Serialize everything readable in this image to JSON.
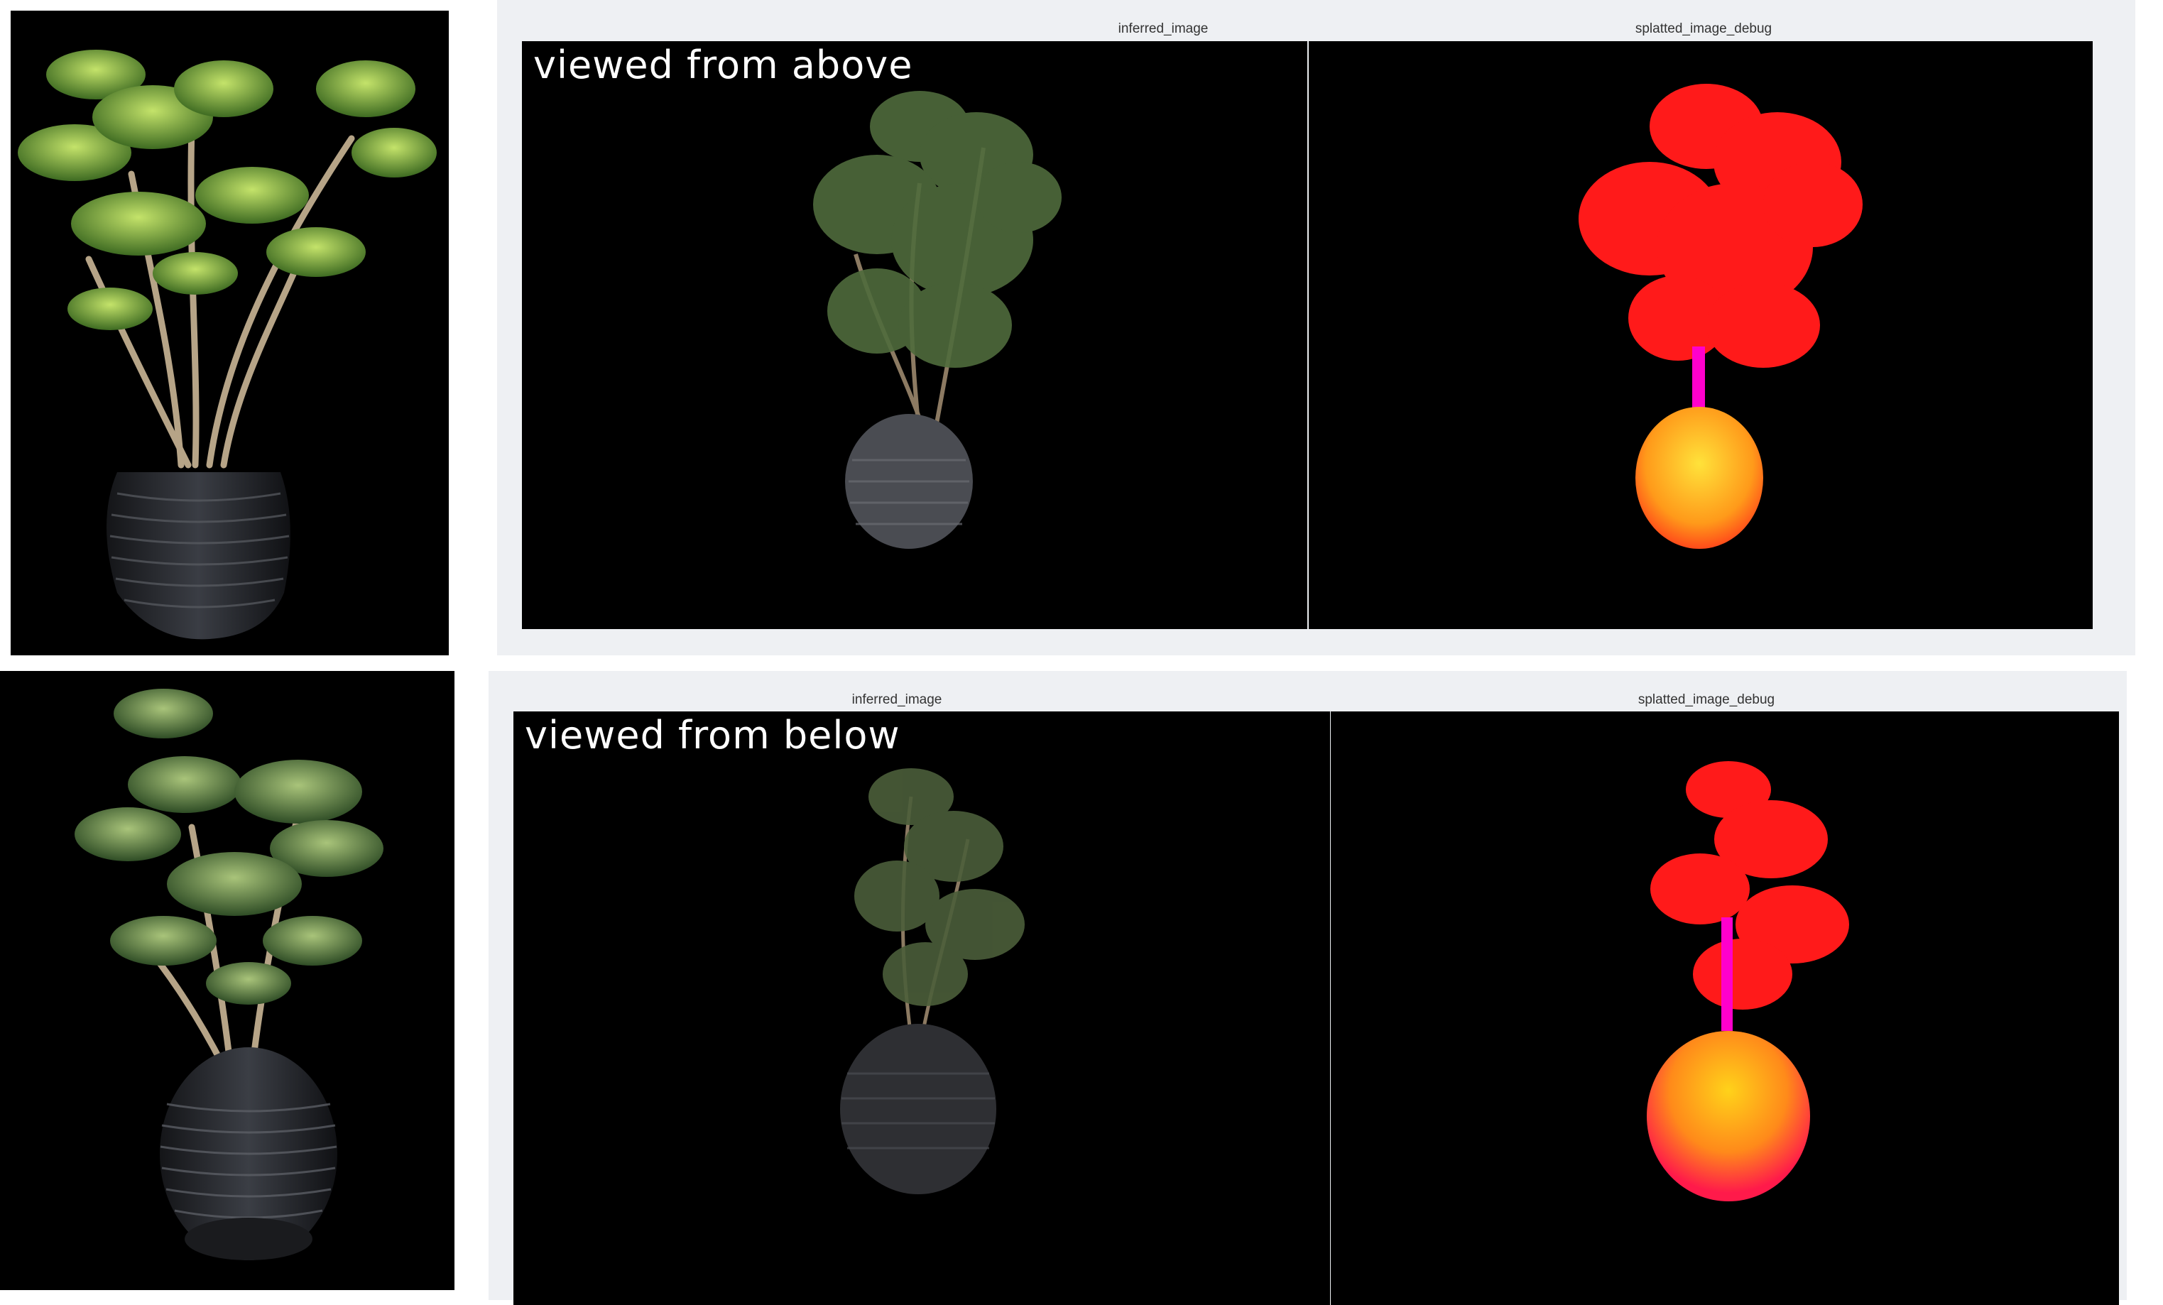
{
  "top_row": {
    "overlay_label": "viewed from above",
    "left_panel_title": "inferred_image",
    "right_panel_title": "splatted_image_debug"
  },
  "bottom_row": {
    "overlay_label": "viewed from below",
    "left_panel_title": "inferred_image",
    "right_panel_title": "splatted_image_debug"
  },
  "colors": {
    "viewer_bg": "#eef0f3",
    "canvas_bg": "#000000",
    "foliage_rendered": "#4f6b3c",
    "foliage_reference": "#8fb547",
    "pot_reference": "#2a2c30",
    "debug_red": "#ff1a1a",
    "debug_magenta": "#ff00cc",
    "debug_yellow": "#ffd21a"
  }
}
